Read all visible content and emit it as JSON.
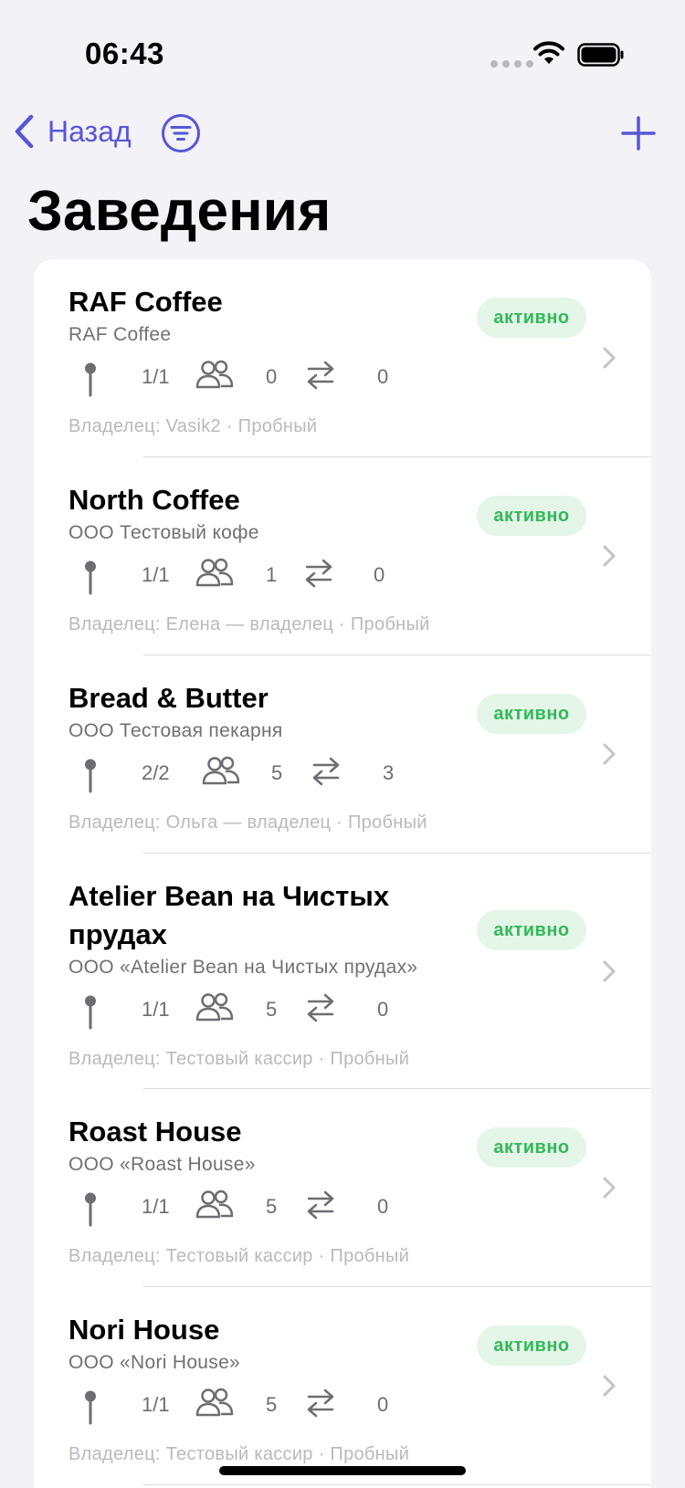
{
  "status_bar": {
    "time": "06:43"
  },
  "nav": {
    "back_label": "Назад",
    "title": "Заведения"
  },
  "venues": [
    {
      "title": "RAF Coffee",
      "subtitle": "RAF Coffee",
      "locations": "1/1",
      "staff": "0",
      "transfers": "0",
      "owner": "Владелец: Vasik2 · Пробный",
      "status": "активно"
    },
    {
      "title": "North Coffee",
      "subtitle": "ООО Тестовый кофе",
      "locations": "1/1",
      "staff": "1",
      "transfers": "0",
      "owner": "Владелец: Елена — владелец · Пробный",
      "status": "активно"
    },
    {
      "title": "Bread & Butter",
      "subtitle": "ООО Тестовая пекарня",
      "locations": "2/2",
      "staff": "5",
      "transfers": "3",
      "owner": "Владелец: Ольга — владелец · Пробный",
      "status": "активно"
    },
    {
      "title": "Atelier Bean на Чистых прудах",
      "subtitle": "ООО «Atelier Bean на Чистых прудах»",
      "locations": "1/1",
      "staff": "5",
      "transfers": "0",
      "owner": "Владелец: Тестовый кассир · Пробный",
      "status": "активно"
    },
    {
      "title": "Roast House",
      "subtitle": "ООО «Roast House»",
      "locations": "1/1",
      "staff": "5",
      "transfers": "0",
      "owner": "Владелец: Тестовый кассир · Пробный",
      "status": "активно"
    },
    {
      "title": "Nori House",
      "subtitle": "ООО «Nori House»",
      "locations": "1/1",
      "staff": "5",
      "transfers": "0",
      "owner": "Владелец: Тестовый кассир · Пробный",
      "status": "активно"
    }
  ],
  "colors": {
    "accent": "#5856d6",
    "status_bg": "#e3f6e7",
    "status_text": "#34b85a",
    "background": "#f2f2f7"
  },
  "icons": {
    "back": "chevron-left-icon",
    "filter": "filter-circle-icon",
    "add": "plus-icon",
    "location": "pin-icon",
    "staff": "people-icon",
    "transfers": "arrows-exchange-icon",
    "row": "chevron-right-icon"
  }
}
